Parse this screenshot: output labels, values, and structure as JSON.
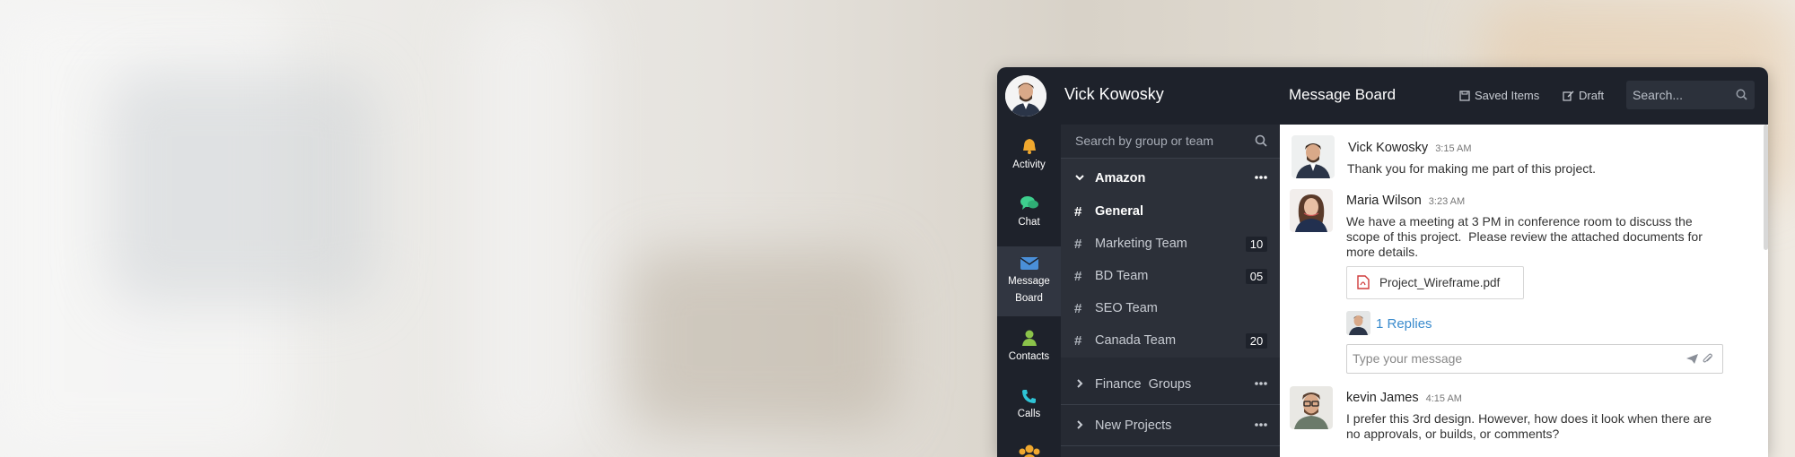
{
  "header": {
    "user_name": "Vick Kowosky",
    "board_title": "Message Board",
    "saved_items_label": "Saved Items",
    "draft_label": "Draft",
    "search_placeholder": "Search..."
  },
  "rail": {
    "items": [
      {
        "label": "Activity",
        "icon": "bell-icon",
        "color": "#f0a82e"
      },
      {
        "label": "Chat",
        "icon": "chat-icon",
        "color": "#3ecf8e"
      },
      {
        "label_line1": "Message",
        "label_line2": "Board",
        "icon": "envelope-icon",
        "color": "#4a8fd8",
        "active": true
      },
      {
        "label": "Contacts",
        "icon": "user-icon",
        "color": "#8bc34a"
      },
      {
        "label": "Calls",
        "icon": "phone-icon",
        "color": "#2ec4d6"
      },
      {
        "icon": "team-icon",
        "color": "#f0a82e"
      }
    ]
  },
  "channels": {
    "search_placeholder": "Search by group or team",
    "groups": [
      {
        "name": "Amazon",
        "expanded": true
      },
      {
        "name": "Finance  Groups",
        "expanded": false
      },
      {
        "name": "New Projects",
        "expanded": false
      }
    ],
    "items": [
      {
        "name": "General",
        "active": true
      },
      {
        "name": "Marketing Team",
        "count": "10"
      },
      {
        "name": "BD Team",
        "count": "05"
      },
      {
        "name": "SEO Team"
      },
      {
        "name": "Canada Team",
        "count": "20"
      }
    ]
  },
  "messages": [
    {
      "author": "Vick Kowosky",
      "time": "3:15 AM",
      "text": "Thank you for making me part of this project."
    },
    {
      "author": "Maria Wilson",
      "time": "3:23 AM",
      "text_line1": "We have a meeting at 3 PM in conference room to discuss the",
      "text_line2": "scope of this project.  Please review the attached documents for",
      "text_line3": "more details.",
      "attachment": "Project_Wireframe.pdf",
      "replies": "1 Replies",
      "reply_placeholder": "Type your message"
    },
    {
      "author": "kevin James",
      "time": "4:15 AM",
      "text_line1": "I prefer this 3rd design. However, how does it look when there are",
      "text_line2": "no approvals, or builds, or comments?"
    }
  ],
  "colors": {
    "dark_bg": "#1e222b",
    "panel_bg": "#262a33",
    "link": "#3a8bcd"
  }
}
